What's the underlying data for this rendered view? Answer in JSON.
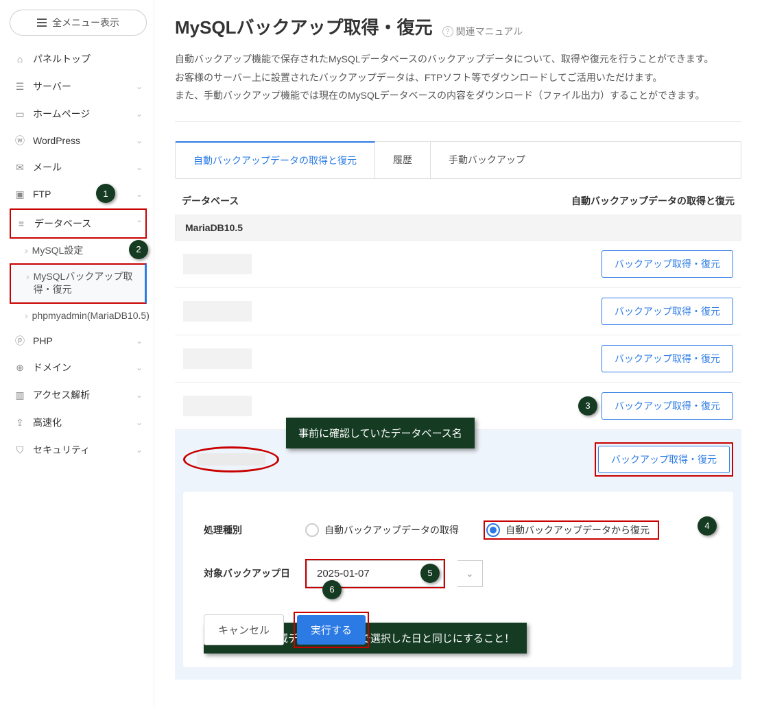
{
  "sidebar": {
    "menu_all": "全メニュー表示",
    "items": [
      {
        "icon": "home",
        "label": "パネルトップ",
        "chev": false
      },
      {
        "icon": "server",
        "label": "サーバー",
        "chev": true
      },
      {
        "icon": "page",
        "label": "ホームページ",
        "chev": true
      },
      {
        "icon": "wp",
        "label": "WordPress",
        "chev": true
      },
      {
        "icon": "mail",
        "label": "メール",
        "chev": true
      },
      {
        "icon": "ftp",
        "label": "FTP",
        "chev": true
      },
      {
        "icon": "db",
        "label": "データベース",
        "chev": true,
        "expanded": true
      },
      {
        "icon": "php",
        "label": "PHP",
        "chev": true
      },
      {
        "icon": "globe",
        "label": "ドメイン",
        "chev": true
      },
      {
        "icon": "chart",
        "label": "アクセス解析",
        "chev": true
      },
      {
        "icon": "speed",
        "label": "高速化",
        "chev": true
      },
      {
        "icon": "shield",
        "label": "セキュリティ",
        "chev": true
      }
    ],
    "db_children": [
      {
        "label": "MySQL設定"
      },
      {
        "label": "MySQLバックアップ取得・復元",
        "active": true
      },
      {
        "label": "phpmyadmin(MariaDB10.5)"
      }
    ]
  },
  "page": {
    "title": "MySQLバックアップ取得・復元",
    "manual_link": "関連マニュアル",
    "desc1": "自動バックアップ機能で保存されたMySQLデータベースのバックアップデータについて、取得や復元を行うことができます。",
    "desc2": "お客様のサーバー上に設置されたバックアップデータは、FTPソフト等でダウンロードしてご活用いただけます。",
    "desc3": "また、手動バックアップ機能では現在のMySQLデータベースの内容をダウンロード（ファイル出力）することができます。"
  },
  "tabs": [
    "自動バックアップデータの取得と復元",
    "履歴",
    "手動バックアップ"
  ],
  "table": {
    "head_left": "データベース",
    "head_right": "自動バックアップデータの取得と復元",
    "group": "MariaDB10.5",
    "btn": "バックアップ取得・復元"
  },
  "callouts": {
    "db_name": "事前に確認していたデータベース名",
    "date_note": "「サーバー領域データ」の復旧で選択した日と同じにすること！"
  },
  "form": {
    "label_type": "処理種別",
    "radio_get": "自動バックアップデータの取得",
    "radio_restore": "自動バックアップデータから復元",
    "label_date": "対象バックアップ日",
    "date_value": "2025-01-07",
    "cancel": "キャンセル",
    "submit": "実行する"
  },
  "badges": {
    "b1": "1",
    "b2": "2",
    "b3": "3",
    "b4": "4",
    "b5": "5",
    "b6": "6"
  }
}
